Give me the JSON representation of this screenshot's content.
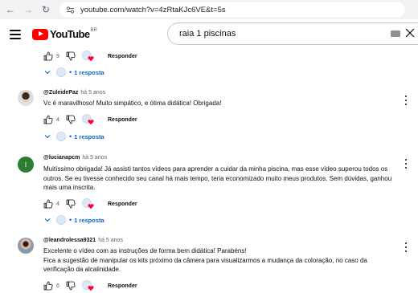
{
  "browser": {
    "url": "youtube.com/watch?v=4zRtaKJc6VE&t=5s"
  },
  "header": {
    "logo_text": "YouTube",
    "country": "BR",
    "search_value": "raia 1 piscinas"
  },
  "colors": {
    "brand_red": "#ff0000",
    "link_blue": "#065fd4",
    "avatar_green": "#2e7d32"
  },
  "top_thread": {
    "likes": "9",
    "reply_label": "Responder",
    "replies_label": "1 resposta"
  },
  "comments": [
    {
      "author": "@ZuleidePaz",
      "time": "há 5 anos",
      "text": "Vc é maravilhoso! Muito simpático, e ótima didática! Obrigada!",
      "likes": "4",
      "reply_label": "Responder",
      "replies_label": "1 resposta"
    },
    {
      "author": "@lucianapcm",
      "time": "há 5 anos",
      "avatar_letter": "l",
      "text": "Muitíssimo obrigada! Já assisti tantos vídeos para aprender a cuidar da minha piscina, mas esse vídeo superou todos os outros. Se eu tivesse conhecido seu canal há mais tempo, teria economizado muito meus produtos. Sem dúvidas, ganhou mais uma inscrita.",
      "likes": "4",
      "reply_label": "Responder",
      "replies_label": "1 resposta"
    },
    {
      "author": "@leandrolessa9321",
      "time": "há 5 anos",
      "text_lines": [
        "Excelente o vídeo com as instruções de forma bem didática! Parabéns!",
        "Fica a sugestão de manipular os kits próximo da câmera para visualizarmos a mudança da coloração, no caso da verificação da alcalinidade."
      ],
      "likes": "6",
      "reply_label": "Responder"
    }
  ]
}
